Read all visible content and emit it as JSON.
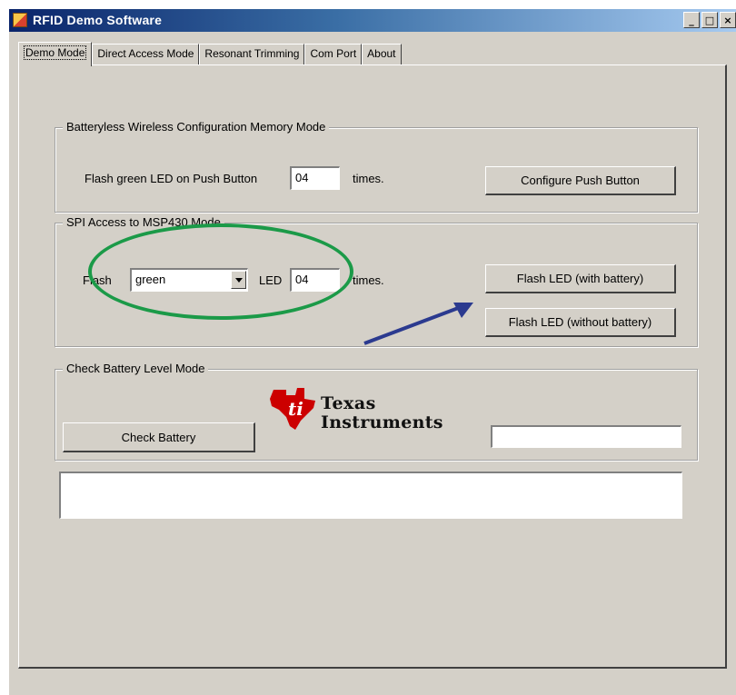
{
  "window": {
    "title": "RFID Demo Software",
    "caption_buttons": {
      "minimize": "_",
      "maximize": "□",
      "close": "×"
    }
  },
  "tabs": [
    {
      "label": "Demo Mode",
      "active": true
    },
    {
      "label": "Direct Access Mode",
      "active": false
    },
    {
      "label": "Resonant Trimming",
      "active": false
    },
    {
      "label": "Com Port",
      "active": false
    },
    {
      "label": "About",
      "active": false
    }
  ],
  "batteryless_group": {
    "title": "Batteryless Wireless  Configuration Memory Mode",
    "flash_label": "Flash green LED on Push Button",
    "count_value": "04",
    "times_label": "times.",
    "configure_button": "Configure Push Button"
  },
  "spi_group": {
    "title": "SPI Access to MSP430 Mode",
    "flash_label": "Flash",
    "color_value": "green",
    "led_label": "LED",
    "count_value": "04",
    "times_label": "times.",
    "flash_with_battery_button": "Flash LED (with battery)",
    "flash_without_battery_button": "Flash LED (without battery)"
  },
  "battery_group": {
    "title": "Check Battery Level Mode",
    "check_button": "Check Battery",
    "level_value": ""
  },
  "logo": {
    "line1": "Texas",
    "line2": "Instruments"
  },
  "output_box": {
    "value": ""
  },
  "annotations": {
    "ellipse_color": "#1b9a48",
    "arrow_color": "#2b3a8f"
  },
  "colors": {
    "titlebar_start": "#0a246a",
    "face": "#d4d0c8",
    "ti_red": "#cc0000"
  }
}
